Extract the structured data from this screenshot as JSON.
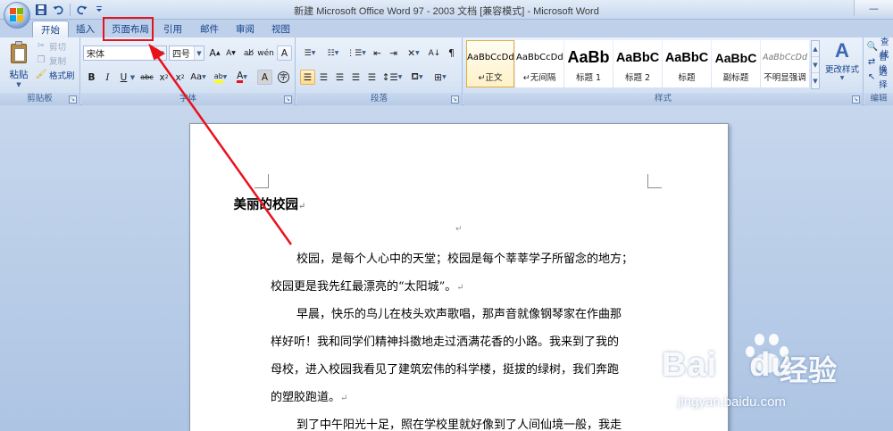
{
  "window": {
    "title": "新建 Microsoft Office Word 97 - 2003 文档 [兼容模式] - Microsoft Word"
  },
  "qat": {
    "icons": [
      "save-icon",
      "undo-icon",
      "redo-icon",
      "customize-icon"
    ]
  },
  "tabs": [
    {
      "label": "开始",
      "active": true
    },
    {
      "label": "插入",
      "active": false
    },
    {
      "label": "页面布局",
      "active": false,
      "highlighted": true
    },
    {
      "label": "引用",
      "active": false
    },
    {
      "label": "邮件",
      "active": false
    },
    {
      "label": "审阅",
      "active": false
    },
    {
      "label": "视图",
      "active": false
    }
  ],
  "clipboard": {
    "paste": "粘贴",
    "cut": "剪切",
    "copy": "复制",
    "format_painter": "格式刷",
    "group_label": "剪贴板"
  },
  "font": {
    "name": "宋体",
    "size": "四号",
    "group_label": "字体",
    "buttons": [
      "A",
      "A",
      "Aa",
      "A",
      "B",
      "I",
      "U",
      "abc",
      "x",
      "x",
      "Aa",
      "ab",
      "A",
      "A"
    ],
    "highlight_color": "#ffff00",
    "font_color": "#e8121c"
  },
  "paragraph": {
    "group_label": "段落"
  },
  "styles": {
    "group_label": "样式",
    "items": [
      {
        "sample": "AaBbCcDd",
        "name": "↵正文",
        "selected": true
      },
      {
        "sample": "AaBbCcDd",
        "name": "↵无间隔",
        "selected": false
      },
      {
        "sample": "AaBb",
        "name": "标题 1",
        "selected": false
      },
      {
        "sample": "AaBbC",
        "name": "标题 2",
        "selected": false
      },
      {
        "sample": "AaBbC",
        "name": "标题",
        "selected": false
      },
      {
        "sample": "AaBbC",
        "name": "副标题",
        "selected": false
      },
      {
        "sample": "AaBbCcDd",
        "name": "不明显强调",
        "selected": false
      }
    ],
    "change_styles": "更改样式"
  },
  "editing": {
    "group_label": "编辑",
    "find": "查找",
    "replace": "替换",
    "select": "选择"
  },
  "document": {
    "title": "美丽的校园",
    "empty_mark": "↵",
    "lines": [
      "校园，是每个人心中的天堂；校园是每个莘莘学子所留念的地方；",
      "校园更是我先红最漂亮的“太阳城”。",
      "早晨，快乐的鸟儿在枝头欢声歌唱，那声音就像钢琴家在作曲那",
      "样好听！我和同学们精神抖擞地走过洒满花香的小路。我来到了我的",
      "母校，进入校园我看见了建筑宏伟的科学楼，挺拔的绿树，我们奔跑",
      "的塑胶跑道。",
      "到了中午阳光十足，照在学校里就好像到了人间仙境一般，我走"
    ],
    "para_mark": "↵"
  },
  "watermark": {
    "brand": "Bai",
    "brand_tail": "du",
    "chinese": "经验",
    "url": "jingyan.baidu.com"
  },
  "colors": {
    "annotation_red": "#e8121c",
    "ribbon_text": "#15428b"
  }
}
